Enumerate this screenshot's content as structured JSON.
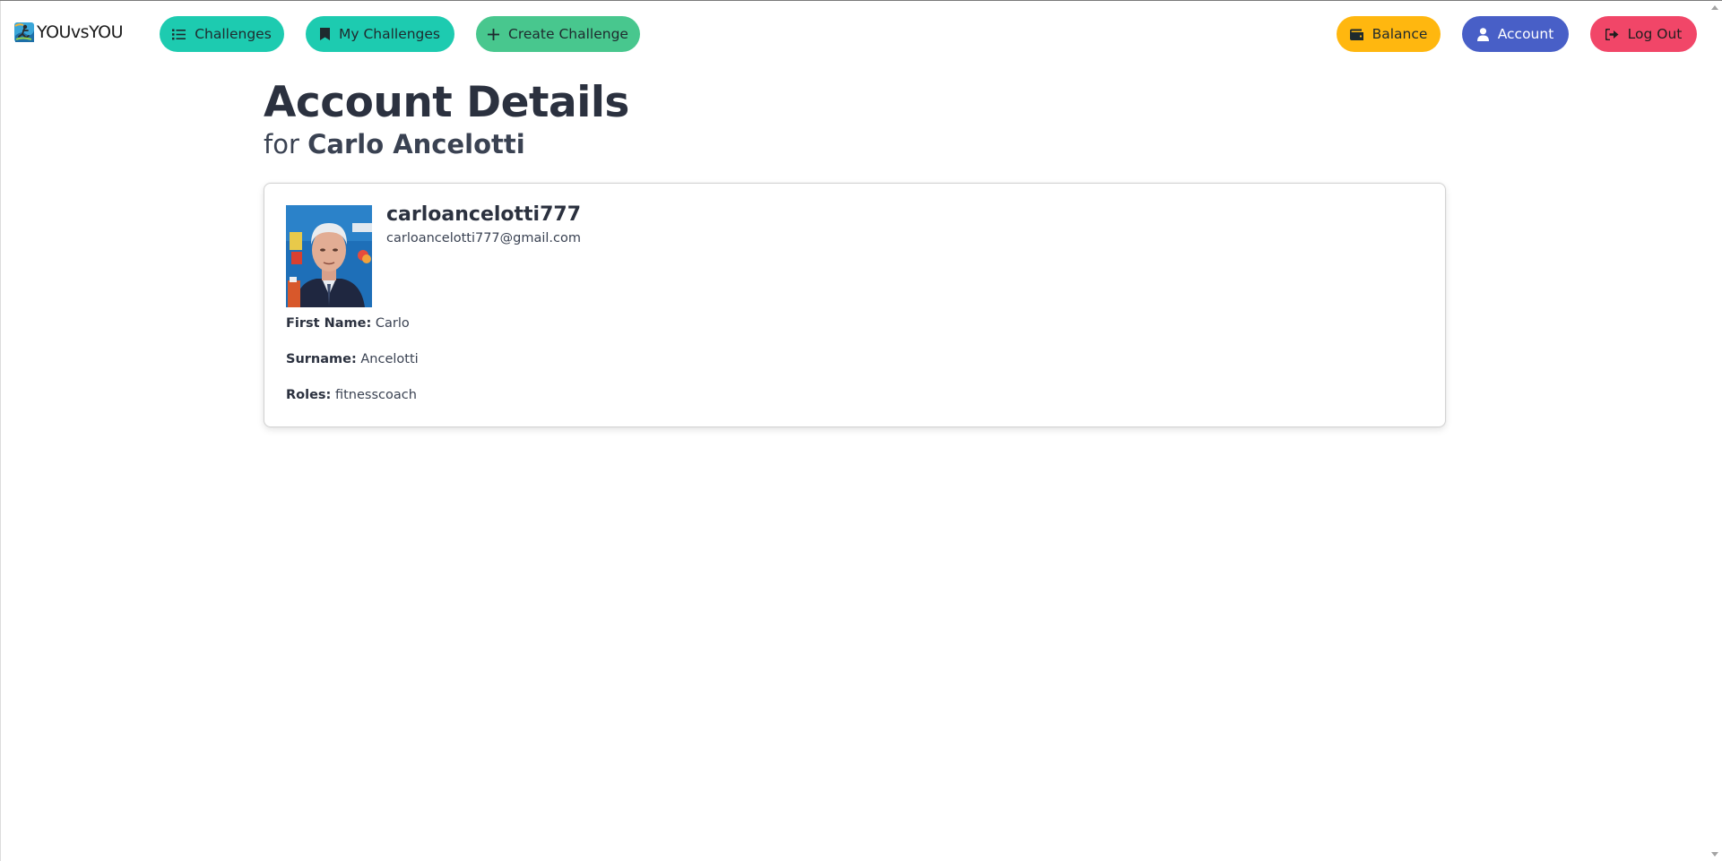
{
  "navbar": {
    "brand": "YOUvsYOU",
    "brand_icon": "athlete-logo-icon",
    "left_buttons": {
      "challenges": {
        "label": "Challenges",
        "icon": "list-icon",
        "color": "#1dcbb0"
      },
      "my_challenges": {
        "label": "My Challenges",
        "icon": "bookmark-icon",
        "color": "#1dcbb0"
      },
      "create_challenge": {
        "label": "Create Challenge",
        "icon": "plus-icon",
        "color": "#48c78e"
      }
    },
    "right_buttons": {
      "balance": {
        "label": "Balance",
        "icon": "wallet-icon",
        "color": "#ffb70f"
      },
      "account": {
        "label": "Account",
        "icon": "user-icon",
        "color": "#485fc7"
      },
      "logout": {
        "label": "Log Out",
        "icon": "sign-out-icon",
        "color": "#f14668"
      }
    }
  },
  "header": {
    "title": "Account Details",
    "subtitle_prefix": "for",
    "full_name": "Carlo Ancelotti"
  },
  "profile": {
    "username": "carloancelotti777",
    "email": "carloancelotti777@gmail.com",
    "fields": {
      "first_name": {
        "label": "First Name:",
        "value": "Carlo"
      },
      "surname": {
        "label": "Surname:",
        "value": "Ancelotti"
      },
      "roles": {
        "label": "Roles:",
        "value": "fitnesscoach"
      }
    }
  }
}
